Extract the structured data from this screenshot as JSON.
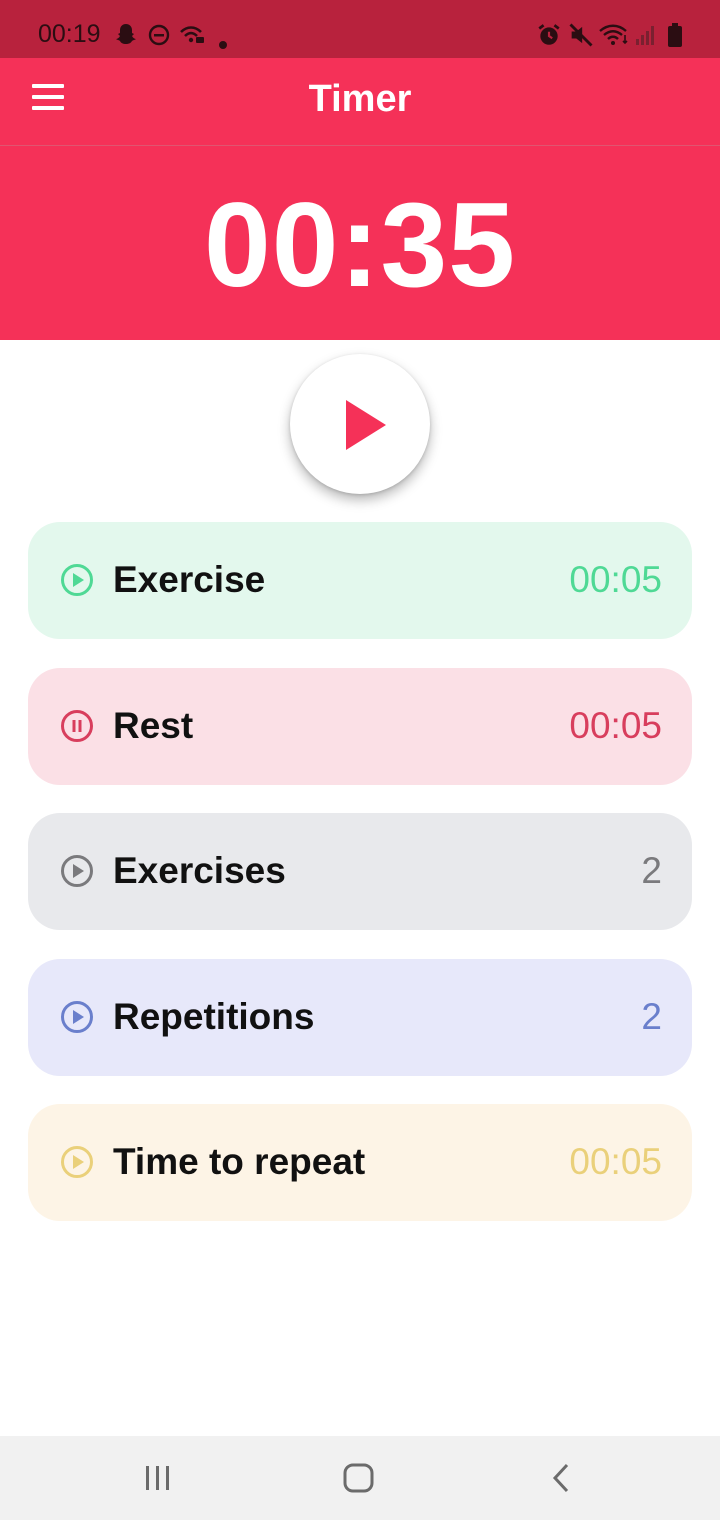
{
  "status_bar": {
    "time": "00:19",
    "left_icons": [
      "snapchat-icon",
      "do-not-disturb-icon",
      "wifi-calling-icon",
      "notification-dot-icon"
    ],
    "right_icons": [
      "alarm-icon",
      "mute-icon",
      "wifi-icon",
      "signal-icon",
      "battery-icon"
    ]
  },
  "app_bar": {
    "title": "Timer",
    "menu_icon": "menu-icon"
  },
  "timer": {
    "display": "00:35"
  },
  "play_button": {
    "icon": "play-icon",
    "color": "#f53158"
  },
  "items": [
    {
      "label": "Exercise",
      "value": "00:05",
      "icon": "play-circle-icon",
      "bg": "#e3f8ed",
      "accent": "#4fd995"
    },
    {
      "label": "Rest",
      "value": "00:05",
      "icon": "pause-circle-icon",
      "bg": "#fbe0e6",
      "accent": "#d83e5d"
    },
    {
      "label": "Exercises",
      "value": "2",
      "icon": "play-circle-icon",
      "bg": "#e8e9ec",
      "accent": "#7a7a7d"
    },
    {
      "label": "Repetitions",
      "value": "2",
      "icon": "play-circle-icon",
      "bg": "#e7e8fa",
      "accent": "#6a7fcc"
    },
    {
      "label": "Time to repeat",
      "value": "00:05",
      "icon": "play-circle-icon",
      "bg": "#fdf4e6",
      "accent": "#ead07a"
    }
  ],
  "nav_bar": {
    "recents_icon": "recents-icon",
    "home_icon": "home-icon",
    "back_icon": "back-icon"
  }
}
